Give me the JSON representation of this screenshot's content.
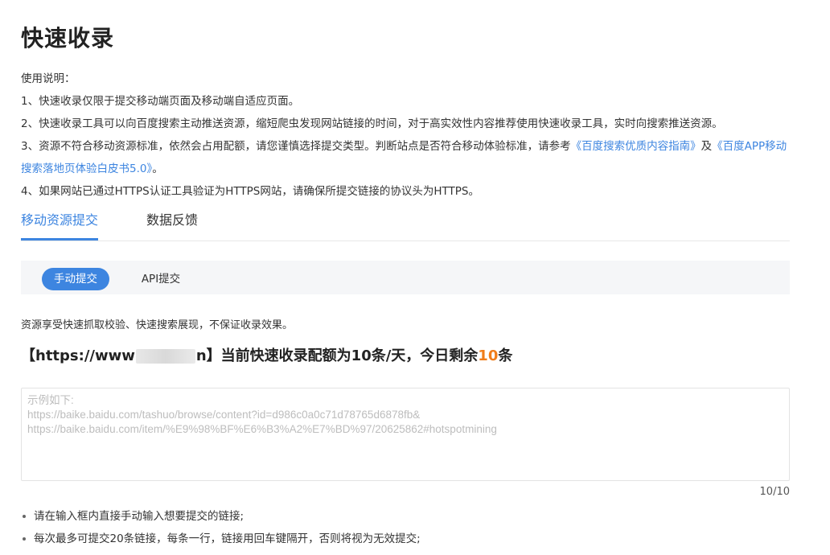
{
  "page": {
    "title": "快速收录"
  },
  "usage": {
    "heading": "使用说明：",
    "item1": "1、快速收录仅限于提交移动端页面及移动端自适应页面。",
    "item2": "2、快速收录工具可以向百度搜索主动推送资源，缩短爬虫发现网站链接的时间，对于高实效性内容推荐使用快速收录工具，实时向搜索推送资源。",
    "item3_prefix": "3、资源不符合移动资源标准，依然会占用配额，请您谨慎选择提交类型。判断站点是否符合移动体验标准，请参考",
    "item3_link1": "《百度搜索优质内容指南》",
    "item3_mid": "及",
    "item3_link2": "《百度APP移动搜索落地页体验白皮书5.0》",
    "item3_suffix": "。",
    "item4": "4、如果网站已通过HTTPS认证工具验证为HTTPS网站，请确保所提交链接的协议头为HTTPS。"
  },
  "tabs": [
    {
      "label": "移动资源提交",
      "active": true
    },
    {
      "label": "数据反馈",
      "active": false
    }
  ],
  "submit_modes": [
    {
      "label": "手动提交",
      "active": true
    },
    {
      "label": "API提交",
      "active": false
    }
  ],
  "note": "资源享受快速抓取校验、快速搜索展现，不保证收录效果。",
  "quota": {
    "prefix": "【https://www",
    "suffix": "n】当前快速收录配额为10条/天，今日剩余",
    "remaining": "10",
    "unit": "条"
  },
  "input": {
    "placeholder_lines": [
      "示例如下:",
      "https://baike.baidu.com/tashuo/browse/content?id=d986c0a0c71d78765d6878fb&",
      "https://baike.baidu.com/item/%E9%98%BF%E6%B3%A2%E7%BD%97/20625862#hotspotmining"
    ],
    "counter": "10/10"
  },
  "tips": [
    "请在输入框内直接手动输入想要提交的链接;",
    "每次最多可提交20条链接，每条一行，链接用回车键隔开，否则将视为无效提交;"
  ],
  "colors": {
    "accent": "#3d85e0",
    "highlight": "#f07d1a"
  }
}
